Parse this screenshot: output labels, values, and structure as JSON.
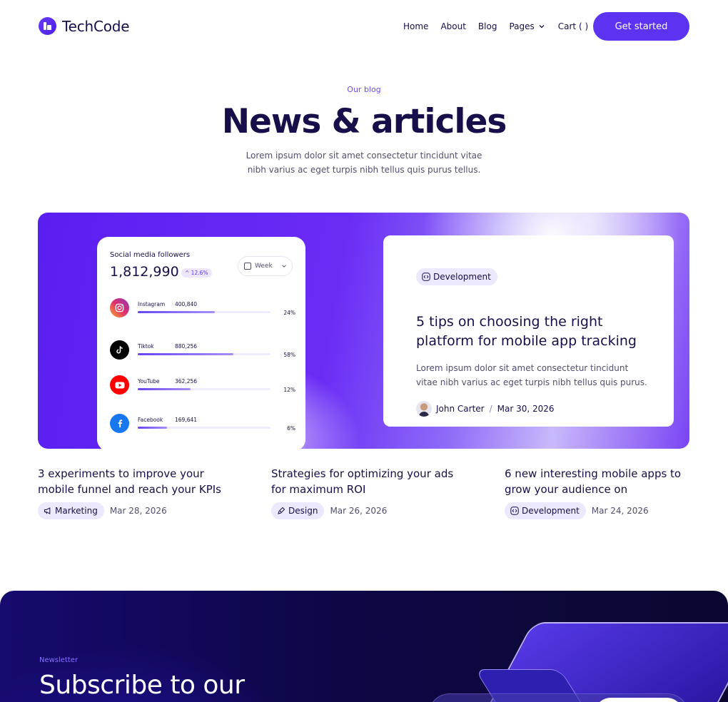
{
  "nav": {
    "brand": "TechCode",
    "items": [
      "Home",
      "About",
      "Blog",
      "Pages",
      "Cart ( )"
    ],
    "cta": "Get started"
  },
  "hero": {
    "eyebrow": "Our blog",
    "title": "News & articles",
    "subtitle": "Lorem ipsum dolor sit amet consectetur tincidunt vitae nibh varius ac eget turpis nibh tellus quis purus tellus."
  },
  "stats": {
    "title": "Social media followers",
    "total": "1,812,990",
    "growth": "^ 12.6%",
    "period": "Week",
    "rows": [
      {
        "name": "Instagram",
        "count": "400,840",
        "pct": "24%",
        "fraction": 0.58,
        "color": "#e1306c",
        "icon": "instagram-icon"
      },
      {
        "name": "Tiktok",
        "count": "880,256",
        "pct": "58%",
        "fraction": 0.72,
        "color": "#000000",
        "icon": "tiktok-icon"
      },
      {
        "name": "YouTube",
        "count": "362,256",
        "pct": "12%",
        "fraction": 0.4,
        "color": "#ff0000",
        "icon": "youtube-icon"
      },
      {
        "name": "Facebook",
        "count": "169,641",
        "pct": "6%",
        "fraction": 0.22,
        "color": "#1877f2",
        "icon": "facebook-icon"
      }
    ]
  },
  "featured": {
    "tag": "Development",
    "title": "5 tips on choosing the right platform for mobile app tracking",
    "excerpt": "Lorem ipsum dolor sit amet consectetur tincidunt vitae nibh varius ac eget turpis nibh tellus quis purus.",
    "author": "John Carter",
    "date": "Mar 30, 2026"
  },
  "posts": [
    {
      "title": "3 experiments to improve your mobile funnel and reach your KPIs",
      "tag": "Marketing",
      "date": "Mar 28, 2026"
    },
    {
      "title": "Strategies for optimizing your ads for maximum ROI",
      "tag": "Design",
      "date": "Mar 26, 2026"
    },
    {
      "title": "6 new interesting mobile apps to grow your audience on",
      "tag": "Development",
      "date": "Mar 24, 2026"
    }
  ],
  "newsletter": {
    "eyebrow": "Newsletter",
    "title": "Subscribe to our"
  },
  "colors": {
    "accent": "#5b33f0",
    "text": "#170f49",
    "muted": "#514f6e"
  }
}
